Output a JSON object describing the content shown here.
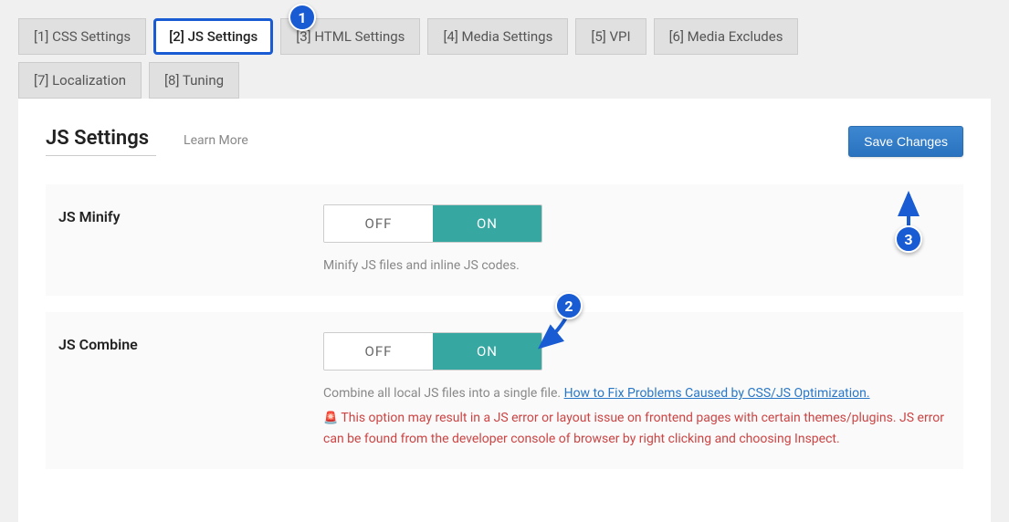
{
  "tabs": {
    "row1": [
      {
        "label": "[1] CSS Settings"
      },
      {
        "label": "[2] JS Settings",
        "active": true
      },
      {
        "label": "[3] HTML Settings"
      },
      {
        "label": "[4] Media Settings"
      },
      {
        "label": "[5] VPI"
      },
      {
        "label": "[6] Media Excludes"
      }
    ],
    "row2": [
      {
        "label": "[7] Localization"
      },
      {
        "label": "[8] Tuning"
      }
    ]
  },
  "header": {
    "title": "JS Settings",
    "learn_more": "Learn More",
    "save": "Save Changes"
  },
  "settings": {
    "minify": {
      "label": "JS Minify",
      "off": "OFF",
      "on": "ON",
      "value": "on",
      "desc": "Minify JS files and inline JS codes."
    },
    "combine": {
      "label": "JS Combine",
      "off": "OFF",
      "on": "ON",
      "value": "on",
      "desc_prefix": "Combine all local JS files into a single file. ",
      "desc_link": "How to Fix Problems Caused by CSS/JS Optimization.",
      "warn_icon": "🚨",
      "warn": " This option may result in a JS error or layout issue on frontend pages with certain themes/plugins. JS error can be found from the developer console of browser by right clicking and choosing Inspect."
    }
  },
  "markers": {
    "m1": "1",
    "m2": "2",
    "m3": "3"
  }
}
